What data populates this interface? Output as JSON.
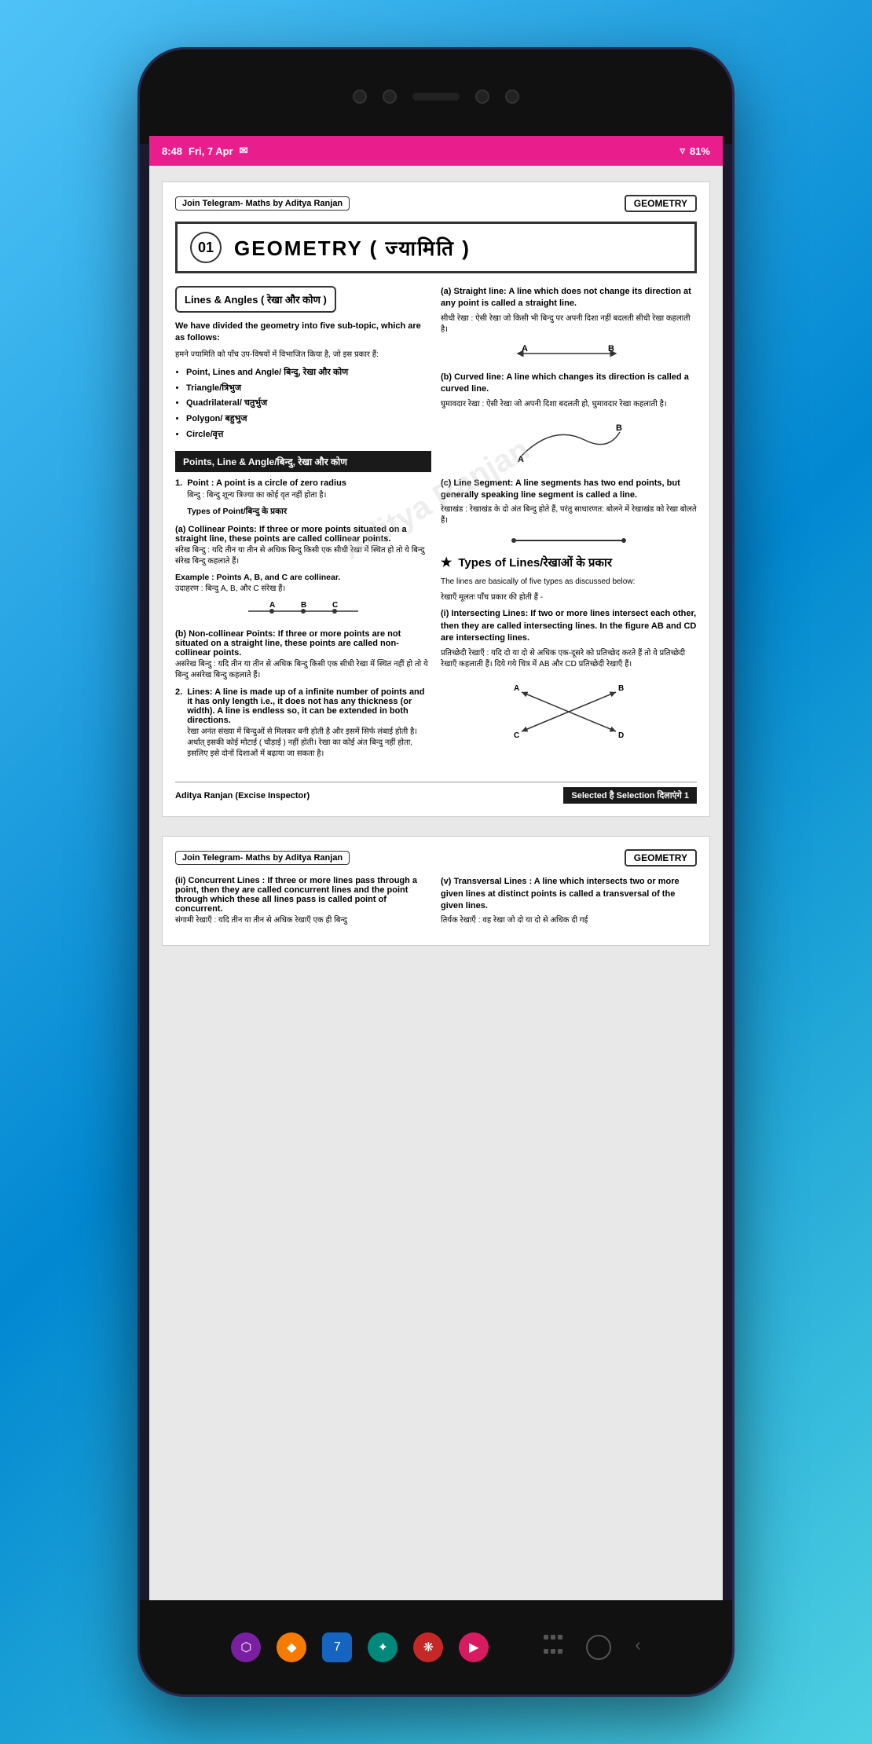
{
  "status": {
    "time": "8:48",
    "date": "Fri, 7 Apr",
    "wifi": "81%",
    "battery": "81%"
  },
  "page1": {
    "telegram_badge": "Join Telegram- Maths by Aditya Ranjan",
    "geometry_badge": "GEOMETRY",
    "title_number": "01",
    "title_text": "GEOMETRY ( ज्यामिति )",
    "section_box": "Lines & Angles ( रेखा और कोण )",
    "intro_bold": "We have divided the geometry into five sub-topic, which are as follows:",
    "intro_hindi": "हमने ज्यामिति को पाँच उप-विषयों में विभाजित किया है, जो इस प्रकार हैं:",
    "bullets": [
      "Point, Lines and Angle/ बिन्दु, रेखा और कोण",
      "Triangle/त्रिभुज",
      "Quadrilateral/ चतुर्भुज",
      "Polygon/ बहुभुज",
      "Circle/वृत्त"
    ],
    "section_header": "Points, Line & Angle/बिन्दु, रेखा और कोण",
    "point_title": "Point : A point is a circle of zero radius",
    "point_hindi": "बिन्दु : बिन्दु शून्य त्रिज्या का कोई वृत नहीं होता है।",
    "types_of_point": "Types of Point/बिन्दु के प्रकार",
    "collinear_title": "(a) Collinear Points: If three or more points situated on a straight line, these points are called collinear points.",
    "collinear_hindi": "संरेख बिन्दु : यदि तीन या तीन से अधिक बिन्दु किसी एक सीधी रेखा में स्थित हो तो ये बिन्दु संरेख बिन्दु कहलाते हैं।",
    "example_text": "Example : Points A, B, and C are collinear.",
    "example_hindi": "उदाहरण : बिन्दु A, B, और C संरेख हैं।",
    "non_collinear_title": "(b) Non-collinear Points: If three or more points are not situated on a straight line, these points are called non-collinear points.",
    "non_collinear_hindi": "असंरेख बिन्दु : यदि तीन या तीन से अधिक बिन्दु किसी एक सीधी रेखा में स्थित नहीं हो तो ये बिन्दु असंरेख बिन्दु कहलाते हैं।",
    "lines_title": "Lines: A line is made up of a infinite number of points and it has only length i.e., it does not has any thickness (or width). A line is endless so, it can be extended in both directions.",
    "lines_hindi": "रेखा अनंत संख्या में बिन्दुओं से मिलकर बनी होती है और इसमें सिर्फ लंबाई होती है। अर्थात् इसकी कोई मोटाई ( चौड़ाई ) नहीं होती। रेखा का कोई अंत बिन्दु नहीं होता, इसलिए इसे दोनों दिशाओं में बढ़ाया जा सकता है।",
    "right_a_title": "(a) Straight line: A line which does not change its direction at any point is called a straight line.",
    "right_a_hindi": "सीधी रेखा : ऐसी रेखा जो किसी भी बिन्दु पर अपनी दिशा नहीं बदलती सीधी रेखा कहलाती है।",
    "right_b_title": "(b) Curved line: A line which changes its direction is called a curved line.",
    "right_b_hindi": "घुमावदार रेखा : ऐसी रेखा जो अपनी दिशा बदलती हो, घुमावदार रेखा कहलाती है।",
    "right_c_title": "(c) Line Segment: A line segments has two end points, but generally speaking line segment is called a line.",
    "right_c_hindi": "रेखाखंड : रेखाखंड के दो अंत बिन्दु होते हैं, परंतु साधारणत: बोलने में रेखाखंड को रेखा बोलते हैं।",
    "types_lines_title": "Types of Lines/रेखाओं के प्रकार",
    "types_lines_body": "The lines are basically of five types as discussed below:",
    "types_lines_hindi": "रेखाएँ मूलतः पाँच प्रकार की होती हैं -",
    "intersecting_title": "(i) Intersecting Lines: If two or more lines intersect each other, then they are called intersecting lines. In the figure AB and CD are intersecting lines.",
    "intersecting_hindi": "प्रतिच्छेदी रेखाएँ : यदि दो या दो से अधिक एक-दूसरे को प्रतिच्छेद करते हैं तो वे प्रतिच्छेदी रेखाएँ कहलाती हैं। दिये गये चित्र में AB और CD प्रतिच्छेदी रेखाएँ हैं।",
    "footer_left": "Aditya Ranjan (Excise Inspector)",
    "footer_right": "Selected है Selection दिलाएंगे 1"
  },
  "page2": {
    "telegram_badge": "Join Telegram- Maths by Aditya Ranjan",
    "geometry_badge": "GEOMETRY",
    "concurrent_title": "(ii) Concurrent Lines : If three or more lines pass through a point, then they are called concurrent lines and the point through which these all lines pass is called point of concurrent.",
    "concurrent_hindi": "संगामी रेखाएँ : यदि तीन या तीन से अधिक रेखाएँ एक ही बिन्दु",
    "transversal_title": "(v) Transversal Lines : A line which intersects two or more given lines at distinct points is called a transversal of the given lines.",
    "transversal_hindi": "तिर्यक रेखाएँ : वह रेखा जो दो या दो से अधिक दी गई"
  },
  "nav": {
    "dots_label": "⠿",
    "circle_label": "○",
    "chevron_label": "‹"
  }
}
